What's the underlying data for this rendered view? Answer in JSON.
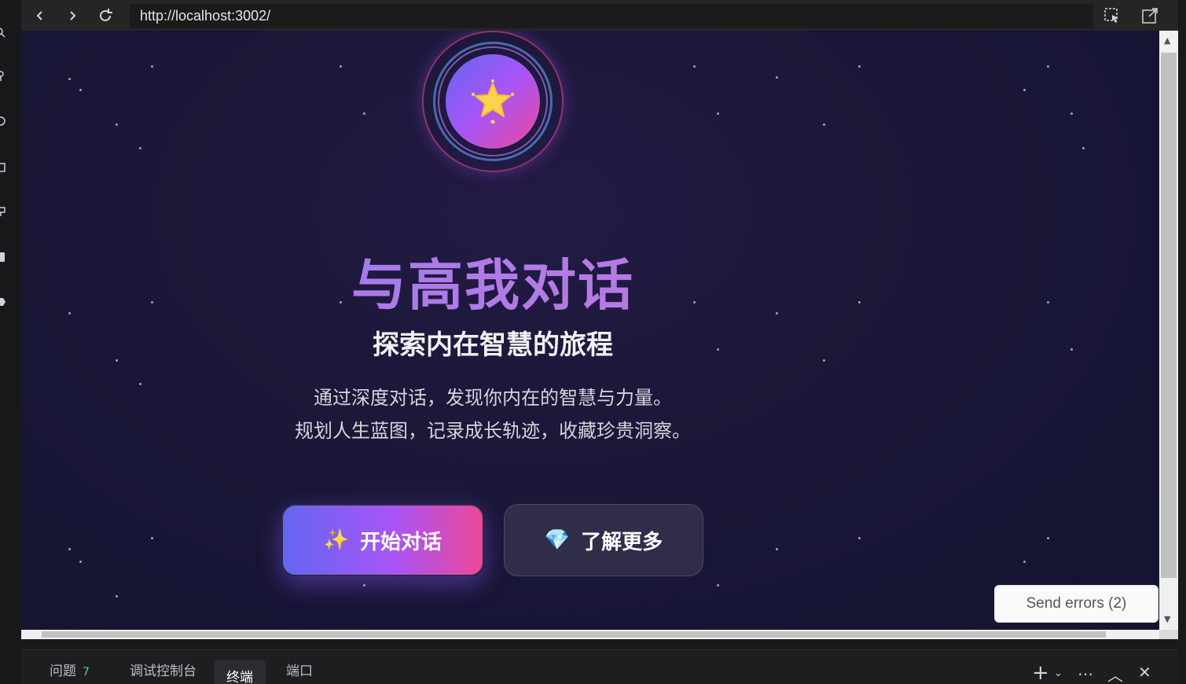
{
  "browser": {
    "url": "http://localhost:3002/"
  },
  "hero": {
    "title": "与高我对话",
    "subtitle": "探索内在智慧的旅程",
    "desc_line1": "通过深度对话，发现你内在的智慧与力量。",
    "desc_line2": "规划人生蓝图，记录成长轨迹，收藏珍贵洞察。"
  },
  "buttons": {
    "primary": {
      "icon": "✨",
      "label": "开始对话"
    },
    "secondary": {
      "icon": "💎",
      "label": "了解更多"
    }
  },
  "overlay": {
    "send_errors": "Send errors (2)"
  },
  "panel": {
    "tabs": [
      {
        "label": "问题",
        "badge": "7"
      },
      {
        "label": "调试控制台"
      },
      {
        "label": "终端",
        "active": true
      },
      {
        "label": "端口"
      }
    ]
  },
  "colors": {
    "accent_indigo": "#6366f1",
    "accent_purple": "#a855f7",
    "accent_pink": "#ec4899",
    "background": "#1b1838"
  }
}
